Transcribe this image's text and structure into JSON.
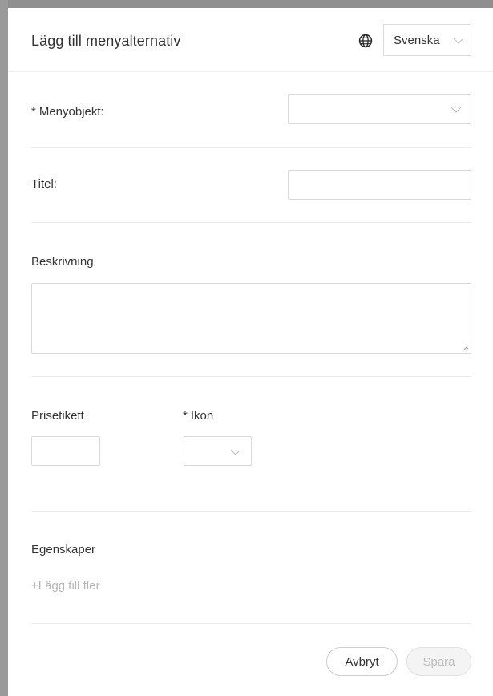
{
  "modal": {
    "title": "Lägg till menyalternativ",
    "language": {
      "selected": "Svenska",
      "icon": "globe-icon"
    }
  },
  "form": {
    "menu_item": {
      "required_mark": "*",
      "label": "Menyobjekt:",
      "value": ""
    },
    "title": {
      "label": "Titel:",
      "value": ""
    },
    "description": {
      "label": "Beskrivning",
      "value": ""
    },
    "price_tag": {
      "label": "Prisetikett",
      "value": ""
    },
    "icon": {
      "required_mark": "*",
      "label": "Ikon",
      "value": ""
    },
    "properties": {
      "label": "Egenskaper",
      "add_more": "+Lägg till fler"
    }
  },
  "footer": {
    "cancel_label": "Avbryt",
    "save_label": "Spara"
  }
}
